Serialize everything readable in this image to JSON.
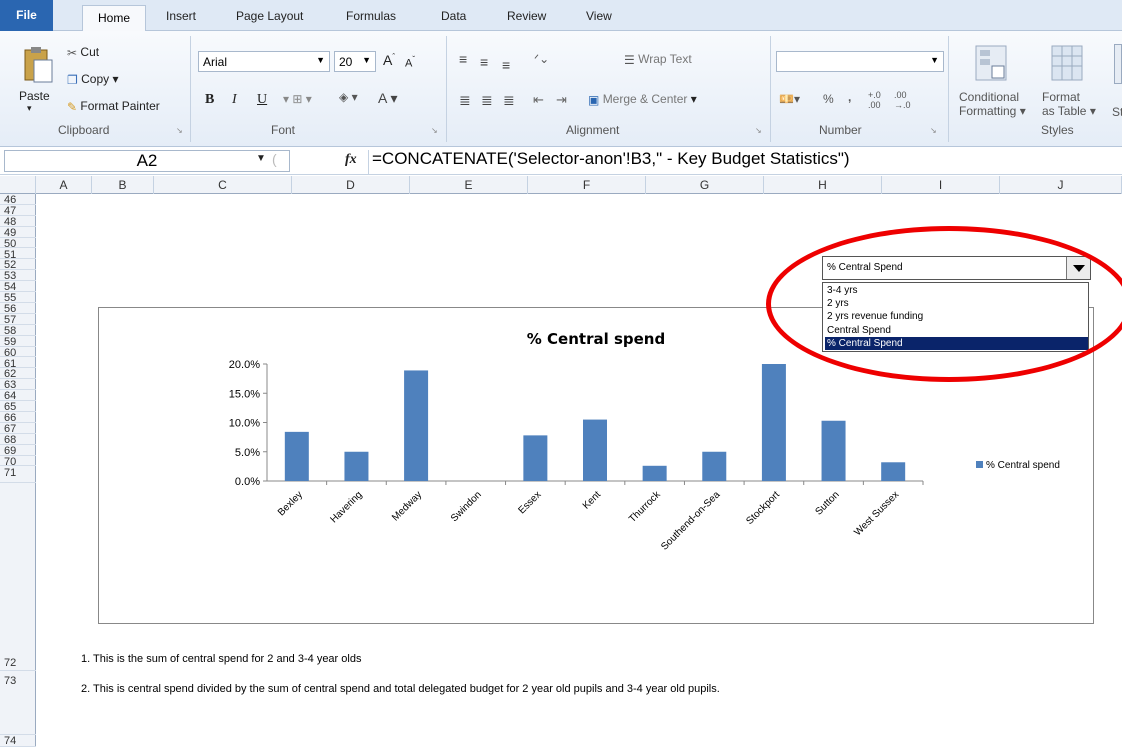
{
  "ribbon": {
    "tabs": [
      "File",
      "Home",
      "Insert",
      "Page Layout",
      "Formulas",
      "Data",
      "Review",
      "View"
    ],
    "clipboard": {
      "paste": "Paste",
      "cut": "Cut",
      "copy": "Copy",
      "format_painter": "Format Painter",
      "label": "Clipboard"
    },
    "font": {
      "name": "Arial",
      "size": "20",
      "label": "Font"
    },
    "alignment": {
      "wrap": "Wrap Text",
      "merge": "Merge & Center",
      "label": "Alignment"
    },
    "number": {
      "format": "",
      "percent": "%",
      "comma": ",",
      "label": "Number"
    },
    "styles": {
      "conditional": "Conditional",
      "conditional2": "Formatting",
      "format": "Format",
      "format2": "as Table",
      "cell": "St",
      "label": "Styles"
    }
  },
  "formula_bar": {
    "cell_ref": "A2",
    "fx": "fx",
    "formula": "=CONCATENATE('Selector-anon'!B3,\" - Key Budget Statistics\")"
  },
  "columns": [
    "A",
    "B",
    "C",
    "D",
    "E",
    "F",
    "G",
    "H",
    "I",
    "J"
  ],
  "rows": [
    "46",
    "47",
    "48",
    "49",
    "50",
    "51",
    "52",
    "53",
    "54",
    "55",
    "56",
    "57",
    "58",
    "59",
    "60",
    "61",
    "62",
    "63",
    "64",
    "65",
    "66",
    "67",
    "68",
    "69",
    "70",
    "71",
    "72",
    "73",
    "74"
  ],
  "dropdown": {
    "selected": "% Central Spend",
    "options": [
      "3-4 yrs",
      "2 yrs",
      "2 yrs revenue funding",
      "Central Spend",
      "% Central Spend"
    ],
    "selected_index": 4
  },
  "chart_data": {
    "type": "bar",
    "title": "% Central spend",
    "categories": [
      "Bexley",
      "Havering",
      "Medway",
      "Swindon",
      "Essex",
      "Kent",
      "Thurrock",
      "Southend-on-Sea",
      "Stockport",
      "Sutton",
      "West Sussex"
    ],
    "series": [
      {
        "name": "% Central spend",
        "values": [
          8.4,
          5.0,
          18.9,
          0.0,
          7.8,
          10.5,
          2.6,
          5.0,
          20.0,
          10.3,
          3.2
        ],
        "color": "#4f81bd"
      }
    ],
    "yticks": [
      "0.0%",
      "5.0%",
      "10.0%",
      "15.0%",
      "20.0%"
    ],
    "ylim": [
      0,
      20
    ],
    "legend": "right"
  },
  "notes": [
    "1. This is the sum of central spend for 2 and 3-4 year olds",
    "2. This is central spend divided by the sum of central spend and total delegated budget for 2 year old pupils and 3-4 year old pupils."
  ]
}
